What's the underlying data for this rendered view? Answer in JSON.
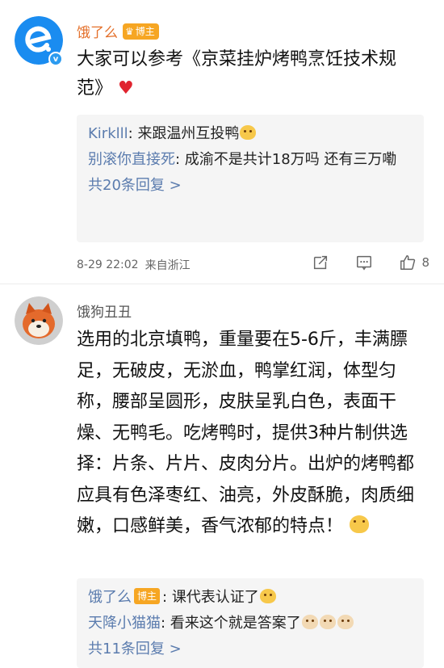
{
  "comments": [
    {
      "author": "饿了么",
      "badge": "博主",
      "text_before_heart": "大家可以参考《京菜挂炉烤鸭烹饪技术规范》",
      "replies": [
        {
          "user": "Kirklll",
          "sep": ": ",
          "text": "来跟温州互投鸭"
        },
        {
          "user": "别滚你直接死",
          "sep": ": ",
          "text": "成渝不是共计18万吗 还有三万嘞"
        }
      ],
      "more": "共20条回复 >",
      "time": "8-29 22:02",
      "location": "来自浙江",
      "likes": "8"
    },
    {
      "author": "饿狗丑丑",
      "text": "选用的北京填鸭，重量要在5-6斤，丰满膘足，无破皮，无淤血，鸭掌红润，体型匀称，腰部呈圆形，皮肤呈乳白色，表面干燥、无鸭毛。吃烤鸭时，提供3种片制供选择：片条、片片、皮肉分片。出炉的烤鸭都应具有色泽枣红、油亮，外皮酥脆，肉质细嫩，口感鲜美，香气浓郁的特点！",
      "replies": [
        {
          "user": "饿了么",
          "badge": "博主",
          "sep": ": ",
          "text": "课代表认证了"
        },
        {
          "user": "天降小猫猫",
          "sep": ": ",
          "text": "看来这个就是答案了"
        }
      ],
      "more": "共11条回复 >"
    }
  ],
  "icons": {
    "verified": "verified-v-icon",
    "share": "share-icon",
    "comment": "comment-icon",
    "like": "thumbs-up-icon"
  },
  "colors": {
    "author_orange": "#e4702b",
    "link_blue": "#5b7cae",
    "badge_orange": "#f6a623",
    "brand_blue": "#2c9bf0"
  }
}
